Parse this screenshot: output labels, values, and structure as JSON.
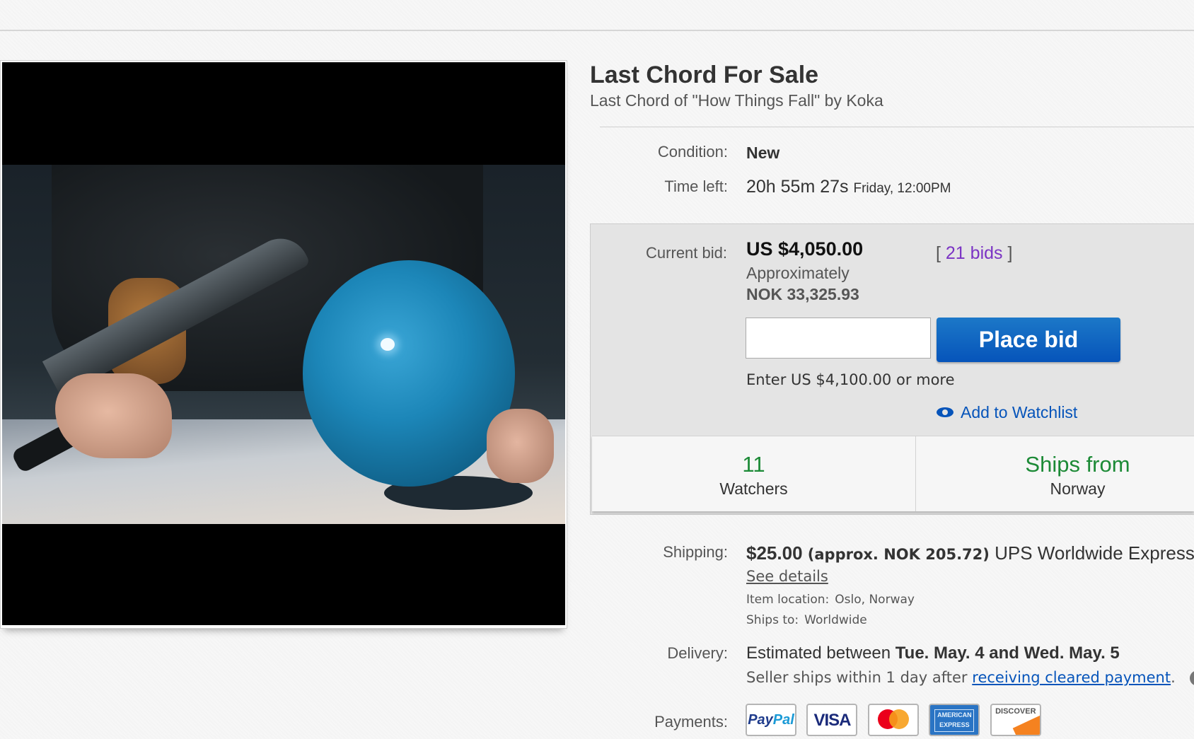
{
  "listing": {
    "title": "Last Chord For Sale",
    "subtitle": "Last Chord of \"How Things Fall\" by Koka"
  },
  "condition": {
    "label": "Condition:",
    "value": "New"
  },
  "time_left": {
    "label": "Time left:",
    "value": "20h 55m 27s",
    "ends": "Friday, 12:00PM"
  },
  "bid": {
    "label": "Current bid:",
    "value": "US $4,050.00",
    "approx_label": "Approximately",
    "approx_value": "NOK 33,325.93",
    "bids_open": "[",
    "bids_link": "21 bids",
    "bids_close": "]",
    "input_value": "",
    "button_label": "Place bid",
    "hint": "Enter US $4,100.00 or more",
    "watchlist_label": "Add to Watchlist"
  },
  "stats": {
    "watchers_count": "11",
    "watchers_label": "Watchers",
    "ships_title": "Ships from",
    "ships_value": "Norway"
  },
  "shipping": {
    "label": "Shipping:",
    "price": "$25.00",
    "approx": "(approx. NOK 205.72)",
    "service": "UPS Worldwide Express |",
    "details_link": "See details",
    "location_label": "Item location:",
    "location_value": "Oslo, Norway",
    "ships_to_label": "Ships to:",
    "ships_to_value": "Worldwide"
  },
  "delivery": {
    "label": "Delivery:",
    "prefix": "Estimated between",
    "range": "Tue. May. 4 and Wed. May. 5",
    "seller_prefix": "Seller ships within 1 day after",
    "seller_link": "receiving cleared payment",
    "seller_suffix": ".",
    "help": "?"
  },
  "payments": {
    "label": "Payments:",
    "methods": [
      "PayPal",
      "VISA",
      "mastercard",
      "AMERICAN EXPRESS",
      "DISCOVER"
    ]
  },
  "colors": {
    "button_blue": "#0654ba",
    "link_purple": "#7b34c4",
    "stat_green": "#1c8a36"
  }
}
